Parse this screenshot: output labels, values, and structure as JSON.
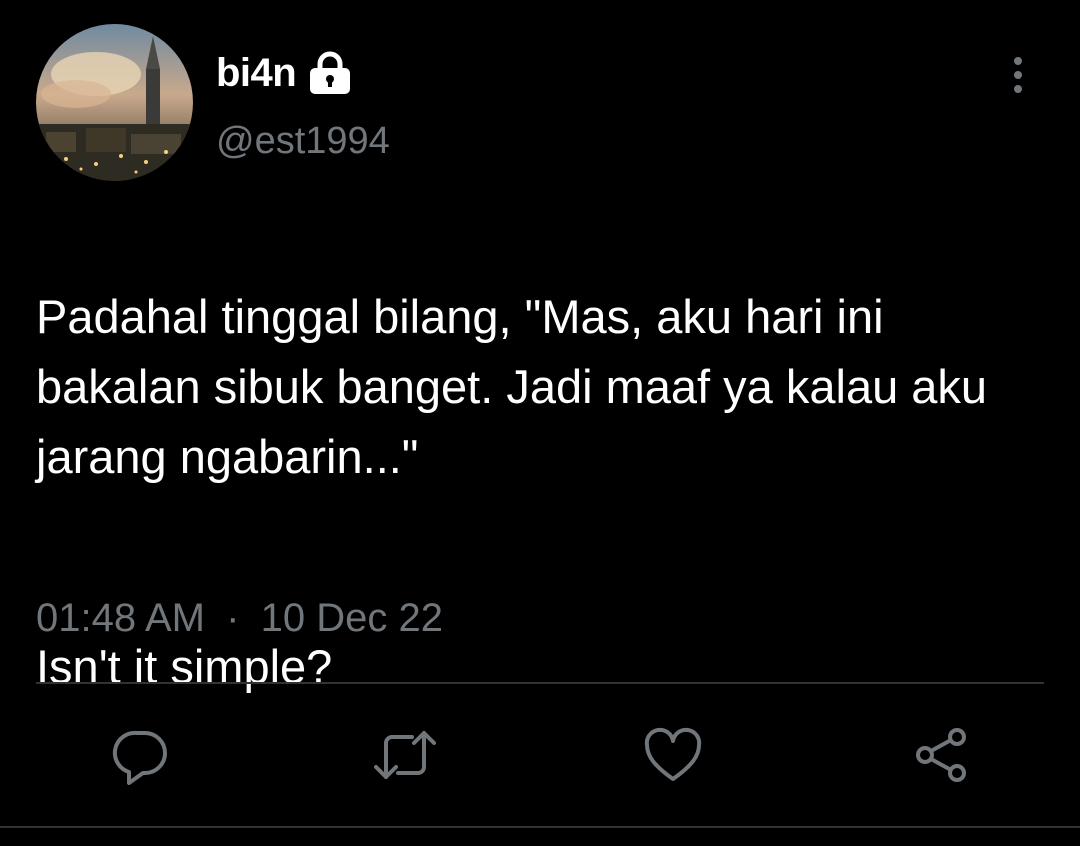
{
  "tweet": {
    "author": {
      "display_name": "bi4n",
      "handle": "@est1994",
      "protected_icon": "lock-icon",
      "avatar": "avatar-painting-city-spire"
    },
    "menu_icon": "more-vertical-icon",
    "text_paragraph_1": "Padahal tinggal bilang, \"Mas, aku hari ini bakalan sibuk banget. Jadi maaf ya kalau aku jarang ngabarin...\"",
    "text_paragraph_2": "Isn't it simple?",
    "time": "01:48 AM",
    "separator": "·",
    "date": "10 Dec 22"
  },
  "actions": {
    "reply_icon": "reply-icon",
    "retweet_icon": "retweet-icon",
    "like_icon": "like-heart-icon",
    "share_icon": "share-icon"
  },
  "colors": {
    "background": "#000000",
    "text_primary": "#ffffff",
    "text_secondary": "#71767b",
    "divider": "#2f3336"
  }
}
